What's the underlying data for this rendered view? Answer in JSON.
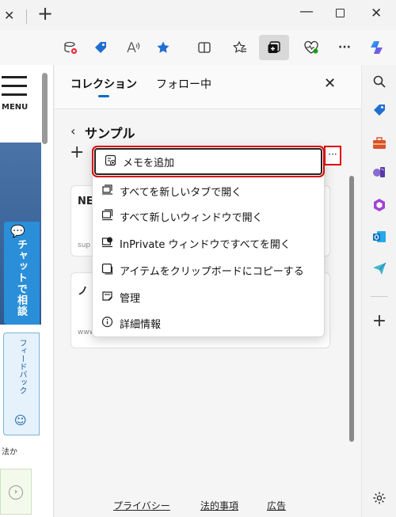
{
  "window": {
    "tab_close": "✕",
    "new_tab": "+",
    "minimize": "—",
    "close": "✕"
  },
  "toolbar": {
    "read_aloud": "Ă"
  },
  "webpage": {
    "menu_label": "MENU",
    "chat_label": "チャットで相談",
    "feedback_label": "フィードバック",
    "partial_text": "法か"
  },
  "panel": {
    "tab_collections": "コレクション",
    "tab_following": "フォロー中",
    "collection_title": "サンプル",
    "more_label": "···",
    "cards": [
      {
        "title": "NE",
        "subtitle": "sup"
      },
      {
        "title": "ノ",
        "subtitle": "www"
      }
    ],
    "footer": {
      "privacy": "プライバシー",
      "legal": "法的事項",
      "ads": "広告"
    }
  },
  "context_menu": {
    "items": [
      {
        "label": "メモを追加",
        "icon": "note-icon"
      },
      {
        "label": "すべてを新しいタブで開く",
        "icon": "open-tabs-icon"
      },
      {
        "label": "すべて新しいウィンドウで開く",
        "icon": "open-window-icon"
      },
      {
        "label": "InPrivate ウィンドウですべてを開く",
        "icon": "inprivate-icon"
      },
      {
        "label": "アイテムをクリップボードにコピーする",
        "icon": "copy-icon"
      },
      {
        "label": "管理",
        "icon": "manage-icon"
      },
      {
        "label": "詳細情報",
        "icon": "info-icon"
      }
    ]
  },
  "colors": {
    "accent": "#0b6cc7",
    "highlight": "#e00000",
    "chat_blue": "#2a8fd8"
  }
}
